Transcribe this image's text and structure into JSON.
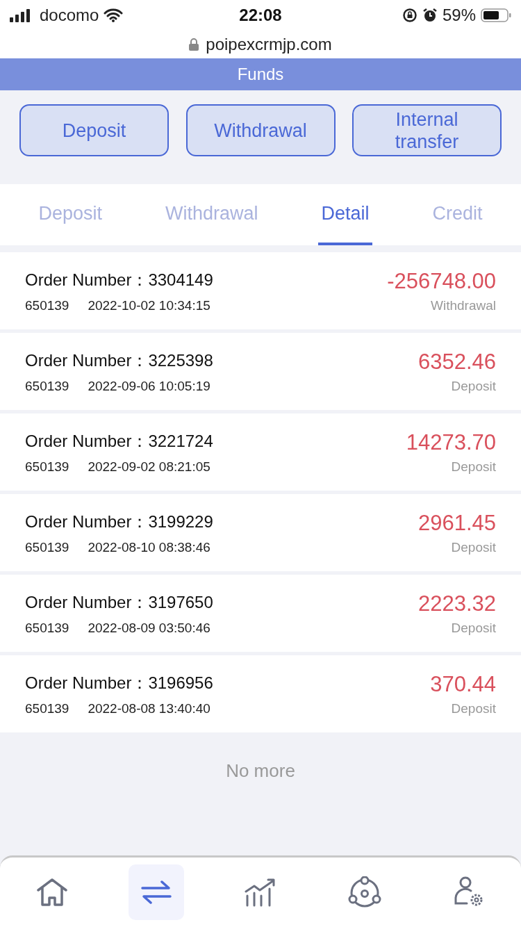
{
  "status_bar": {
    "carrier": "docomo",
    "time": "22:08",
    "battery": "59%"
  },
  "url": "poipexcrmjp.com",
  "header": {
    "title": "Funds"
  },
  "actions": [
    "Deposit",
    "Withdrawal",
    "Internal\ntransfer"
  ],
  "tabs": [
    {
      "label": "Deposit",
      "selected": false
    },
    {
      "label": "Withdrawal",
      "selected": false
    },
    {
      "label": "Detail",
      "selected": true
    },
    {
      "label": "Credit",
      "selected": false
    }
  ],
  "records": [
    {
      "order": "Order Number：3304149",
      "account": "650139",
      "time": "2022-10-02 10:34:15",
      "amount": "-256748.00",
      "type": "Withdrawal"
    },
    {
      "order": "Order Number：3225398",
      "account": "650139",
      "time": "2022-09-06 10:05:19",
      "amount": "6352.46",
      "type": "Deposit"
    },
    {
      "order": "Order Number：3221724",
      "account": "650139",
      "time": "2022-09-02 08:21:05",
      "amount": "14273.70",
      "type": "Deposit"
    },
    {
      "order": "Order Number：3199229",
      "account": "650139",
      "time": "2022-08-10 08:38:46",
      "amount": "2961.45",
      "type": "Deposit"
    },
    {
      "order": "Order Number：3197650",
      "account": "650139",
      "time": "2022-08-09 03:50:46",
      "amount": "2223.32",
      "type": "Deposit"
    },
    {
      "order": "Order Number：3196956",
      "account": "650139",
      "time": "2022-08-08 13:40:40",
      "amount": "370.44",
      "type": "Deposit"
    }
  ],
  "end_text": "No more",
  "nav": [
    {
      "kind": "home",
      "selected": false
    },
    {
      "kind": "transfer",
      "selected": true
    },
    {
      "kind": "chart",
      "selected": false
    },
    {
      "kind": "network",
      "selected": false
    },
    {
      "kind": "user",
      "selected": false
    }
  ]
}
